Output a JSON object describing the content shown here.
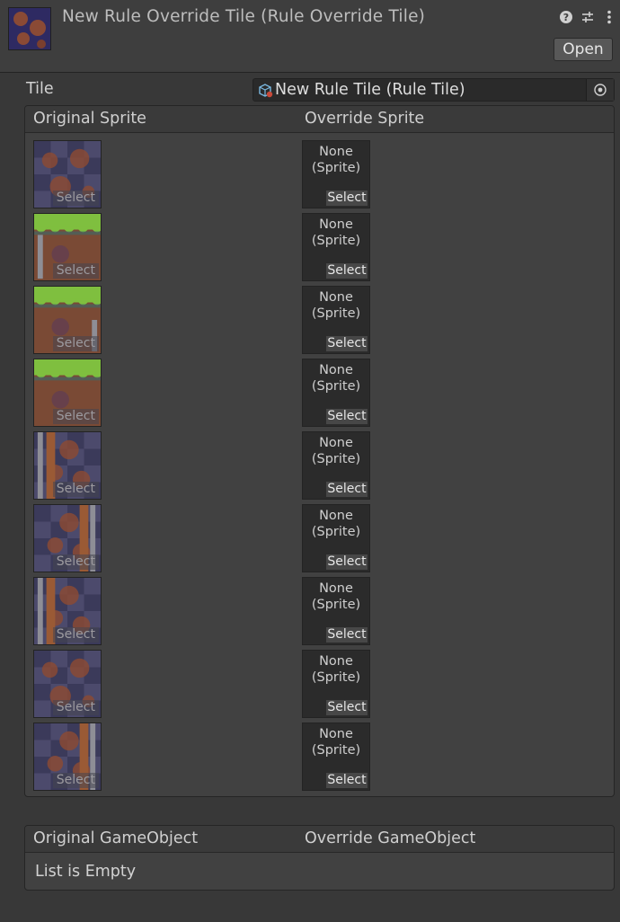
{
  "header": {
    "title": "New Rule Override Tile (Rule Override Tile)",
    "open_label": "Open"
  },
  "tile": {
    "label": "Tile",
    "value": "New Rule Tile (Rule Tile)"
  },
  "sprites_panel": {
    "col_original": "Original Sprite",
    "col_override": "Override Sprite",
    "rows": [
      {
        "original_kind": "dirt",
        "select": "Select",
        "override_text": "None\n(Sprite)",
        "override_select": "Select"
      },
      {
        "original_kind": "grass-left",
        "select": "Select",
        "override_text": "None\n(Sprite)",
        "override_select": "Select"
      },
      {
        "original_kind": "grass-right",
        "select": "Select",
        "override_text": "None\n(Sprite)",
        "override_select": "Select"
      },
      {
        "original_kind": "grass-top",
        "select": "Select",
        "override_text": "None\n(Sprite)",
        "override_select": "Select"
      },
      {
        "original_kind": "wall-left",
        "select": "Select",
        "override_text": "None\n(Sprite)",
        "override_select": "Select"
      },
      {
        "original_kind": "wall-right",
        "select": "Select",
        "override_text": "None\n(Sprite)",
        "override_select": "Select"
      },
      {
        "original_kind": "wall-left-alt",
        "select": "Select",
        "override_text": "None\n(Sprite)",
        "override_select": "Select"
      },
      {
        "original_kind": "dirt-alt",
        "select": "Select",
        "override_text": "None\n(Sprite)",
        "override_select": "Select"
      },
      {
        "original_kind": "wall-right-alt",
        "select": "Select",
        "override_text": "None\n(Sprite)",
        "override_select": "Select"
      }
    ]
  },
  "gameobject_panel": {
    "col_original": "Original GameObject",
    "col_override": "Override GameObject",
    "empty_text": "List is Empty"
  },
  "colors": {
    "background": "#383838",
    "dirt": "#8a4a35",
    "checker_dark": "#3b3a5a",
    "checker_light": "#4c4a6c",
    "grass": "#7fbf3f"
  },
  "icons": [
    "help-icon",
    "presets-icon",
    "kebab-menu-icon",
    "rule-tile-icon",
    "object-picker-icon"
  ]
}
